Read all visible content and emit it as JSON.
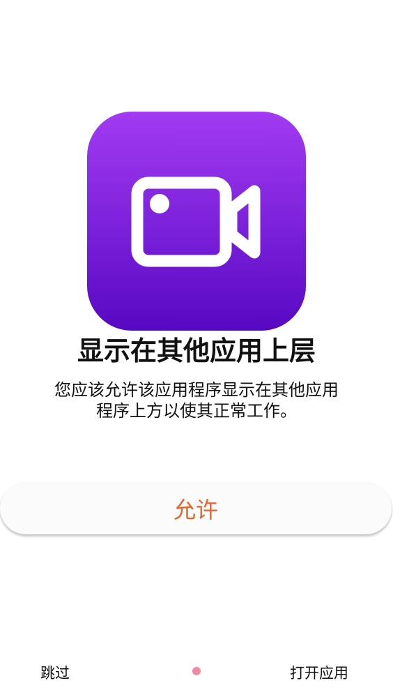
{
  "app_icon": {
    "name": "video-camera-icon",
    "gradient_top": "#a23bf2",
    "gradient_bottom": "#5808c2"
  },
  "title": "显示在其他应用上层",
  "description_line1": "您应该允许该应用程序显示在其他应用",
  "description_line2": "程序上方以使其正常工作。",
  "allow_button_label": "允许",
  "allow_button_color": "#e8622a",
  "bottom_bar": {
    "skip_label": "跳过",
    "open_app_label": "打开应用",
    "indicator_color": "#f08aa0"
  }
}
